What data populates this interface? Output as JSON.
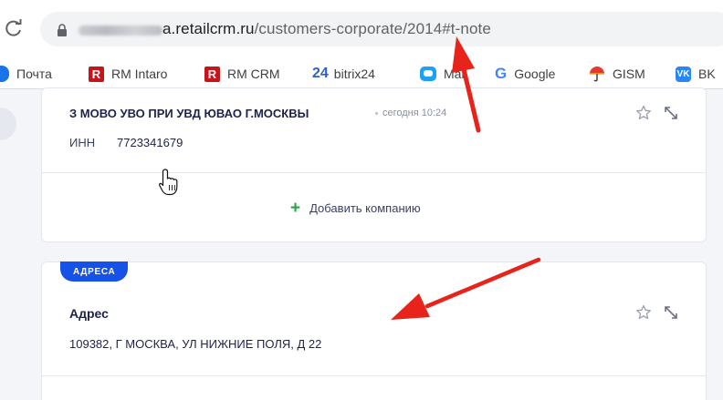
{
  "browser": {
    "url_host": "a.retailcrm.ru",
    "url_path": "/customers-corporate/2014#t-note"
  },
  "bookmarks": [
    {
      "label": "Почта",
      "icon": "blue-icon"
    },
    {
      "label": "RM Intaro",
      "icon": "r-icon"
    },
    {
      "label": "RM CRM",
      "icon": "r-icon"
    },
    {
      "label": "bitrix24",
      "icon": "bitrix24-icon"
    },
    {
      "label": "Mail",
      "icon": "mail-icon"
    },
    {
      "label": "Google",
      "icon": "google-icon"
    },
    {
      "label": "GISM",
      "icon": "gism-icon"
    },
    {
      "label": "BK",
      "icon": "vk-icon"
    }
  ],
  "icon_text": {
    "r": "R",
    "bitrix": "24",
    "google": "G",
    "vk": "VK"
  },
  "company_card": {
    "name": "З МОВО УВО ПРИ УВД ЮВАО Г.МОСКВЫ",
    "time": "сегодня 10:24",
    "inn_label": "ИНН",
    "inn_value": "7723341679",
    "add_company_label": "Добавить компанию"
  },
  "address_card": {
    "tag": "АДРЕСА",
    "title": "Адрес",
    "value": "109382, Г МОСКВА, УЛ НИЖНИЕ ПОЛЯ, Д 22"
  },
  "colors": {
    "accent_blue": "#1652e8",
    "plus_green": "#22a547",
    "annotation_red": "#e8231b"
  }
}
